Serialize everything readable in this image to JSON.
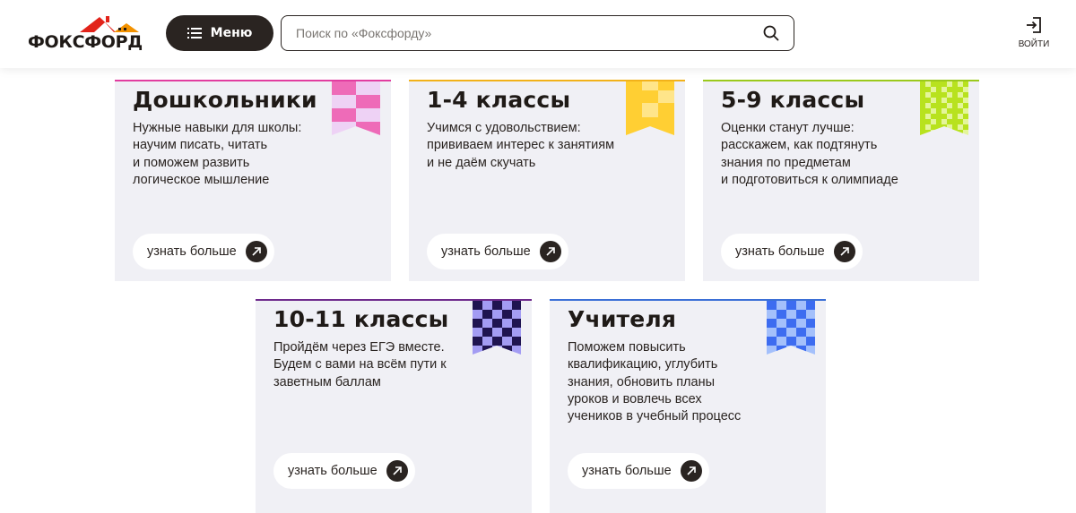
{
  "header": {
    "logo_text": "ФОКСФОРД",
    "menu_label": "Меню",
    "search_placeholder": "Поиск по «Фоксфорду»",
    "login_label": "ВОЙТИ"
  },
  "colors": {
    "dark": "#2a2421",
    "card_bg": "#f0f0f5",
    "logo_red": "#e2231a",
    "logo_orange": "#f39200"
  },
  "cards": [
    {
      "title": "Дошкольники",
      "description": "Нужные навыки для школы:\nнаучим писать, читать\nи поможем развить\nлогическое мышление",
      "button": "узнать больше",
      "accent": "#e23da0",
      "ribbon_colors": [
        "#ee6bb8",
        "#eed2f5"
      ]
    },
    {
      "title": "1-4 классы",
      "description": "Учимся с удовольствием:\nпрививаем интерес к занятиям\nи не даём скучать",
      "button": "узнать больше",
      "accent": "#f2b21a",
      "ribbon_colors": [
        "#ffcf33",
        "#ffe58a"
      ]
    },
    {
      "title": "5-9 классы",
      "description": "Оценки станут лучше:\nрасскажем, как подтянуть\nзнания по предметам\nи подготовиться к олимпиаде",
      "button": "узнать больше",
      "accent": "#9bc91c",
      "ribbon_colors": [
        "#b8e21e",
        "#e4f59a"
      ]
    },
    {
      "title": "10-11 классы",
      "description": "Пройдём через ЕГЭ вместе.\nБудем с вами на всём пути к\nзаветным баллам",
      "button": "узнать больше",
      "accent": "#6e2a8c",
      "ribbon_colors": [
        "#1f1450",
        "#a39cf3"
      ]
    },
    {
      "title": "Учителя",
      "description": "Поможем повысить\nквалификацию, углубить\nзнания, обновить планы\nуроков и вовлечь всех\nучеников в учебный процесс",
      "button": "узнать больше",
      "accent": "#3b6fd6",
      "ribbon_colors": [
        "#3d6cf0",
        "#a4c0fb"
      ]
    }
  ]
}
